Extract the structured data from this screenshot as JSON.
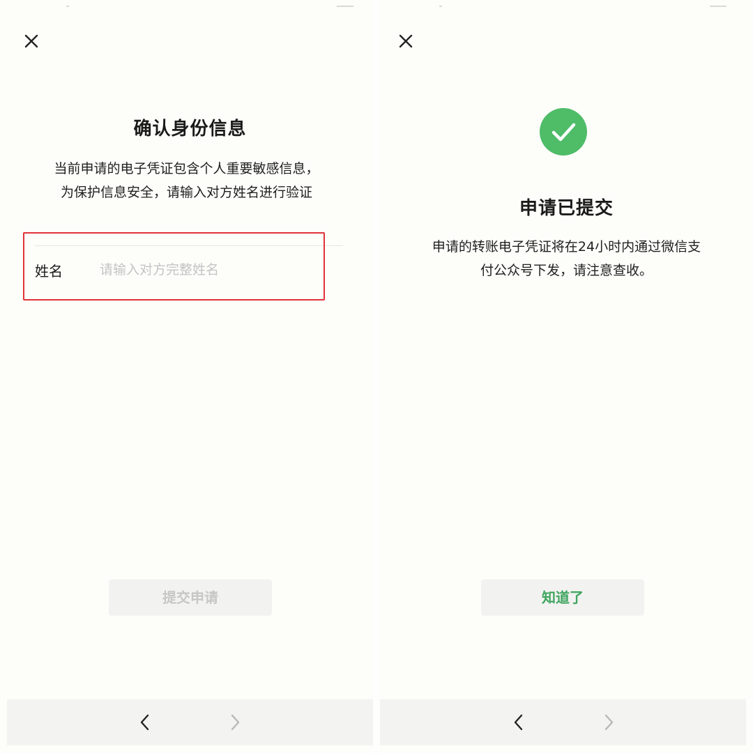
{
  "left_screen": {
    "title": "确认身份信息",
    "description_lines": [
      "当前申请的电子凭证包含个人重要敏感信息，",
      "为保护信息安全，请输入对方姓名进行验证"
    ],
    "name_field": {
      "label": "姓名",
      "value": "",
      "placeholder": "请输入对方完整姓名"
    },
    "submit_label": "提交申请",
    "close_icon": "close-icon",
    "nav": {
      "back_icon": "chevron-left-icon",
      "forward_icon": "chevron-right-icon"
    }
  },
  "right_screen": {
    "status_icon": "check-circle-icon",
    "title": "申请已提交",
    "description_lines": [
      "申请的转账电子凭证将在24小时内通过微信支",
      "付公众号下发，请注意查收。"
    ],
    "ok_label": "知道了",
    "close_icon": "close-icon",
    "nav": {
      "back_icon": "chevron-left-icon",
      "forward_icon": "chevron-right-icon"
    }
  },
  "colors": {
    "highlight_box": "#e0323a",
    "success_green": "#4fbc68",
    "ok_text_green": "#3fa560",
    "disabled_text": "#c7c7c5",
    "button_bg": "#f2f2f0"
  }
}
